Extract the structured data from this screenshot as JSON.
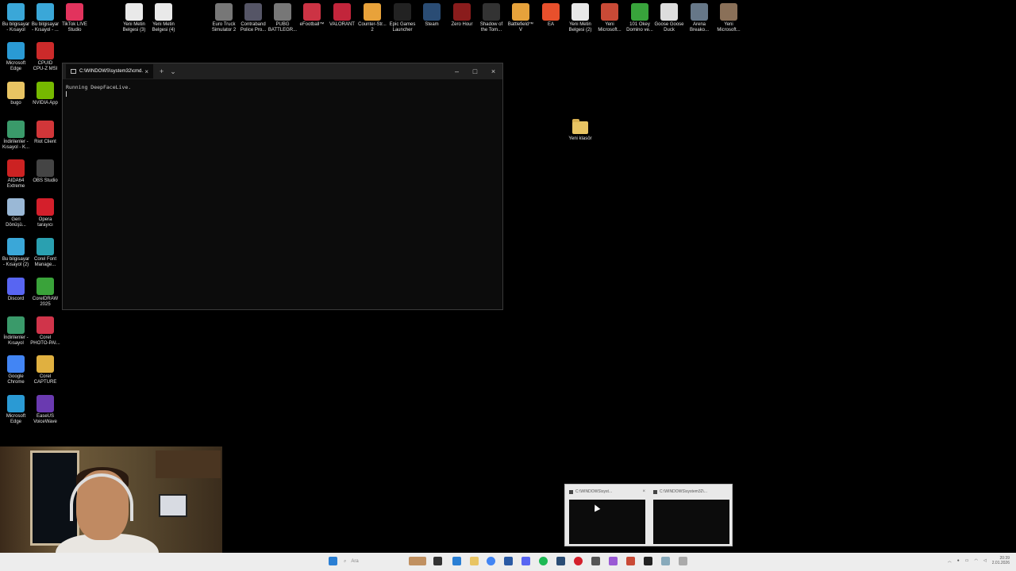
{
  "desktop_icons": [
    {
      "label": "Bu bilgisayar\n- Kısayol",
      "color": "#3aa7d8"
    },
    {
      "label": "Bu bilgisayar\n- Kısayol - ...",
      "color": "#3aa7d8"
    },
    {
      "label": "TikTok LIVE\nStudio",
      "color": "#e2335d"
    },
    {
      "label": "Yeni Metin\nBelgesi (3)",
      "color": "#e9e9e9"
    },
    {
      "label": "Yeni Metin\nBelgesi (4)",
      "color": "#e9e9e9"
    },
    {
      "label": "Euro Truck\nSimulator 2",
      "color": "#777777"
    },
    {
      "label": "Contraband\nPolice Pro...",
      "color": "#555566"
    },
    {
      "label": "PUBG\nBATTLEGR...",
      "color": "#777777"
    },
    {
      "label": "eFootball™",
      "color": "#cc3344"
    },
    {
      "label": "VALORANT",
      "color": "#c2253b"
    },
    {
      "label": "Counter-Str...\n2",
      "color": "#e8a23a"
    },
    {
      "label": "Epic Games\nLauncher",
      "color": "#222222"
    },
    {
      "label": "Steam",
      "color": "#2a4c74"
    },
    {
      "label": "Zero Hour",
      "color": "#8a1c1c"
    },
    {
      "label": "Shadow of\nthe Tom...",
      "color": "#333333"
    },
    {
      "label": "Battlefield™\nV",
      "color": "#e6a23b"
    },
    {
      "label": "EA",
      "color": "#e8502c"
    },
    {
      "label": "Yeni Metin\nBelgesi (2)",
      "color": "#e9e9e9"
    },
    {
      "label": "Yeni\nMicrosoft...",
      "color": "#c94a36"
    },
    {
      "label": "101 Okey\nDomino ve...",
      "color": "#38a33b"
    },
    {
      "label": "Goose Goose\nDuck",
      "color": "#dddddd"
    },
    {
      "label": "Arena\nBreako...",
      "color": "#667788"
    },
    {
      "label": "Yeni\nMicrosoft...",
      "color": "#8a7058"
    },
    {
      "label": "Microsoft\nEdge",
      "color": "#2a9ad4"
    },
    {
      "label": "CPUID\nCPU-Z MSI",
      "color": "#cc2a2a"
    },
    {
      "label": "bugo",
      "color": "#e8c463"
    },
    {
      "label": "NVIDIA App",
      "color": "#76b900"
    },
    {
      "label": "İndirilenler -\nKısayol - K...",
      "color": "#3a9a6a"
    },
    {
      "label": "Riot Client",
      "color": "#d13639"
    },
    {
      "label": "AIDA64\nExtreme",
      "color": "#cc2222"
    },
    {
      "label": "OBS Studio",
      "color": "#444444"
    },
    {
      "label": "Geri\nDönüşü...",
      "color": "#9ab8d6"
    },
    {
      "label": "Opera\ntarayıcı",
      "color": "#d41f2b"
    },
    {
      "label": "Bu bilgisayar\n- Kısayol (2)",
      "color": "#3aa7d8"
    },
    {
      "label": "Corel Font\nManage...",
      "color": "#2aa0b0"
    },
    {
      "label": "Discord",
      "color": "#5865f2"
    },
    {
      "label": "CorelDRAW\n2025",
      "color": "#3aa33a"
    },
    {
      "label": "İndirilenler -\nKısayol",
      "color": "#3a9a6a"
    },
    {
      "label": "Corel\nPHOTO-PAI...",
      "color": "#d0344a"
    },
    {
      "label": "Google\nChrome",
      "color": "#4285f4"
    },
    {
      "label": "Corel\nCAPTURE",
      "color": "#e0b040"
    },
    {
      "label": "Microsoft\nEdge",
      "color": "#2a9ad4"
    },
    {
      "label": "EaseUS\nVoiceWave",
      "color": "#6a3ab0"
    }
  ],
  "terminal": {
    "tab_title": "C:\\WINDOWS\\system32\\cmd.",
    "tab_close": "×",
    "new_tab": "+",
    "dropdown": "⌄",
    "minimize": "–",
    "maximize": "□",
    "close": "×",
    "output_line": "Running DeepFaceLive."
  },
  "folder": {
    "label": "Yeni klasör"
  },
  "previews": [
    {
      "title": "C:\\WINDOWS\\syst...",
      "close": "×"
    },
    {
      "title": "C:\\WINDOWS\\system32\\..."
    }
  ],
  "taskbar": {
    "search_placeholder": "Ara",
    "clock_time": "20:39",
    "clock_date": "2.01.2026"
  }
}
